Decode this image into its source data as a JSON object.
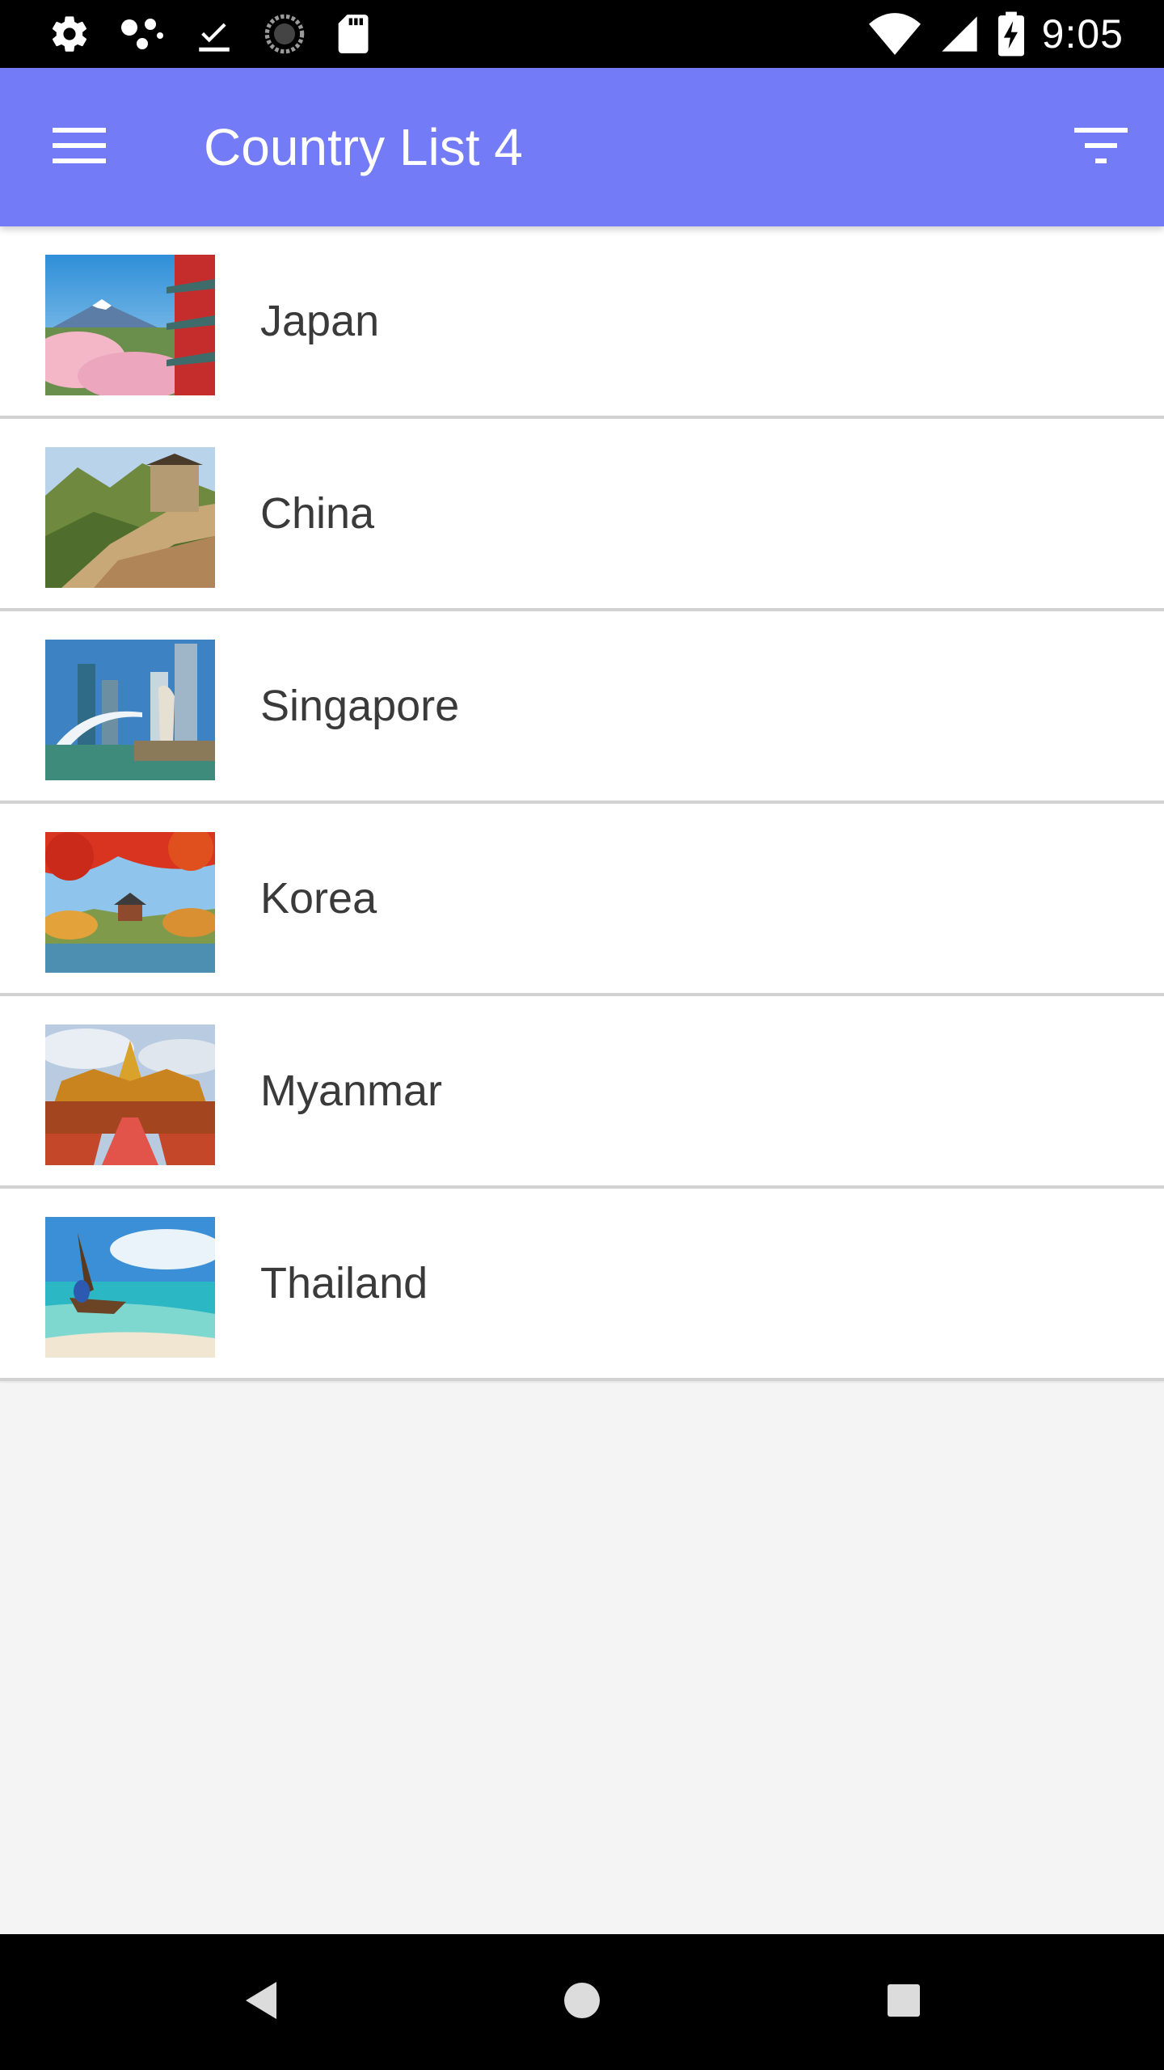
{
  "status_bar": {
    "time": "9:05",
    "icons_left": [
      "settings-icon",
      "dots-icon",
      "download-done-icon",
      "sync-icon",
      "sd-card-icon"
    ],
    "icons_right": [
      "wifi-icon",
      "signal-icon",
      "battery-charging-icon"
    ]
  },
  "app_bar": {
    "title": "Country List 4",
    "color": "#737bf7",
    "menu_icon": "menu-icon",
    "filter_icon": "filter-icon"
  },
  "countries": [
    {
      "name": "Japan"
    },
    {
      "name": "China"
    },
    {
      "name": "Singapore"
    },
    {
      "name": "Korea"
    },
    {
      "name": "Myanmar"
    },
    {
      "name": "Thailand"
    }
  ],
  "nav_bar": {
    "icons": [
      "back-icon",
      "home-icon",
      "recents-icon"
    ]
  }
}
